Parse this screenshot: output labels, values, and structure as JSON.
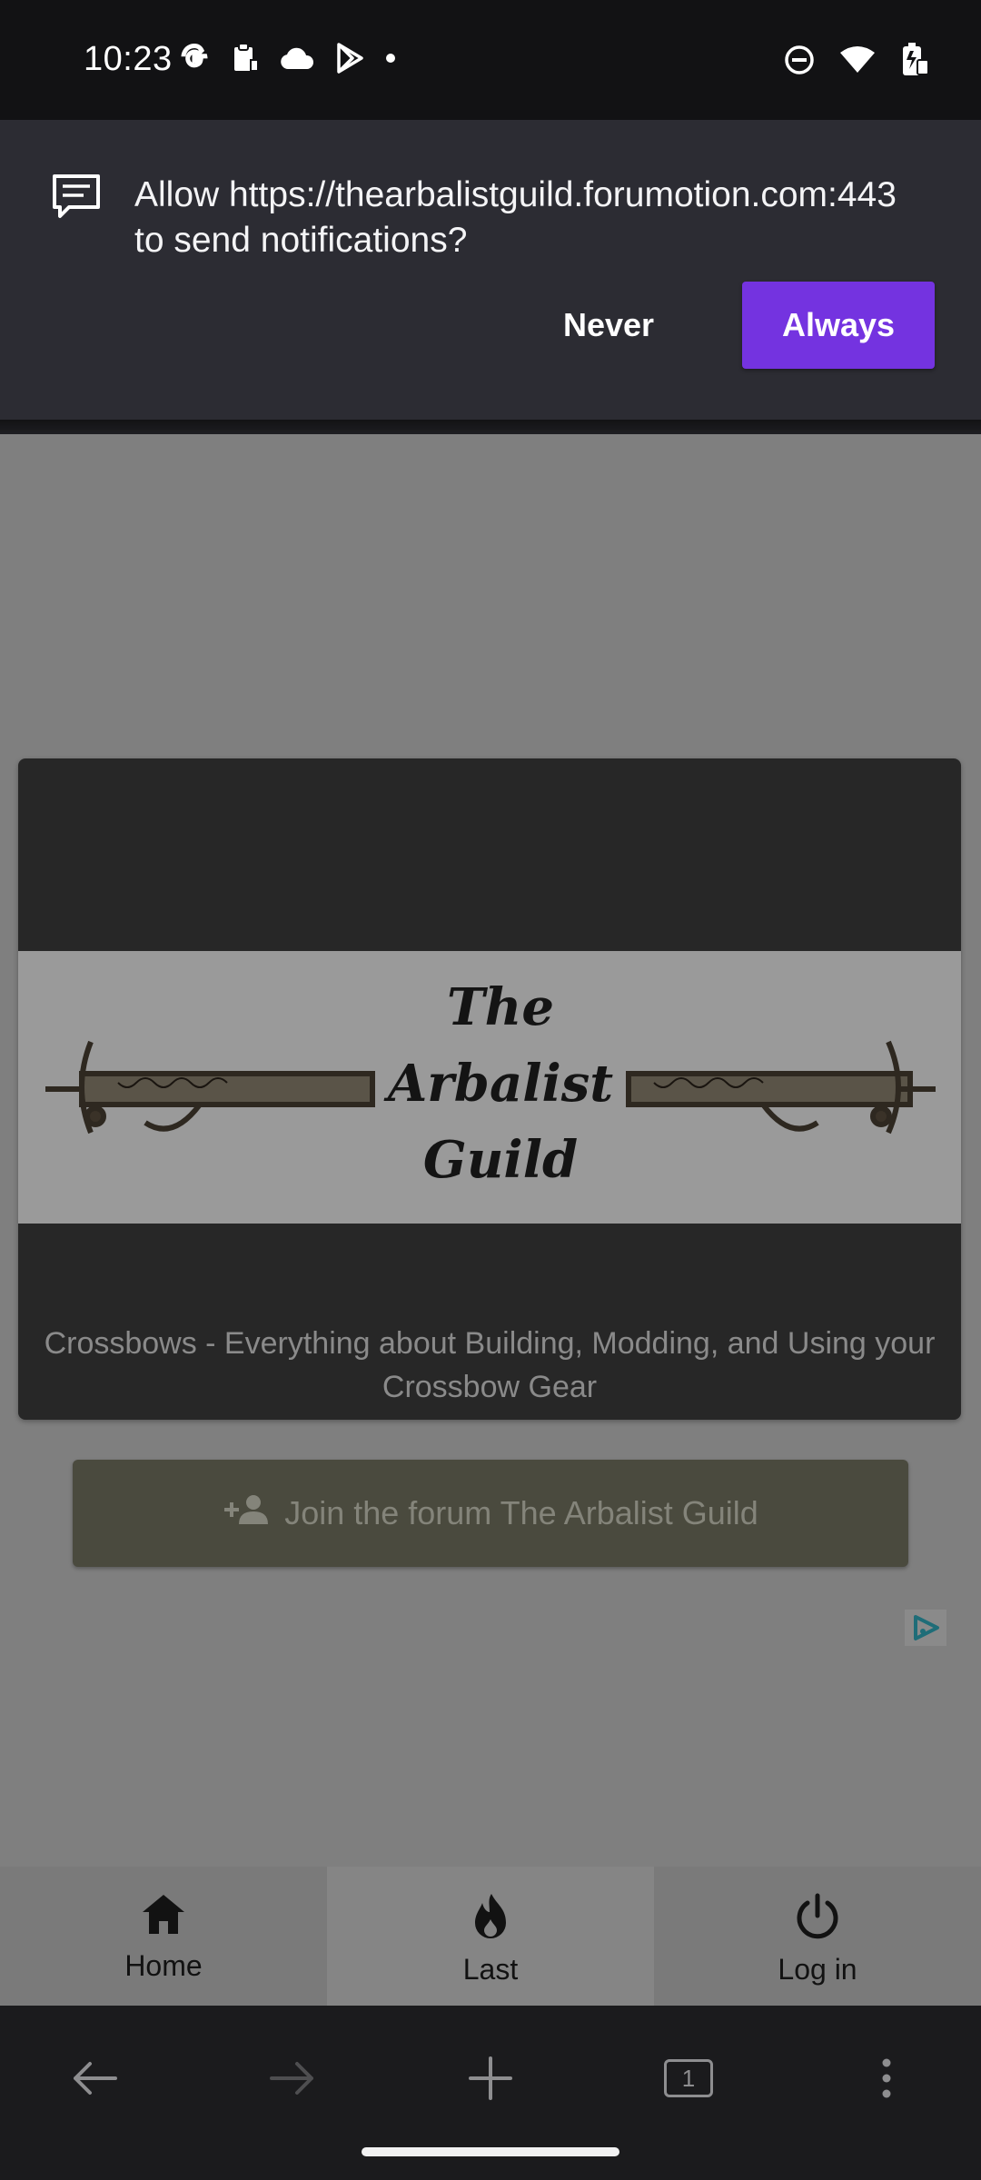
{
  "status_bar": {
    "time": "10:23",
    "left_icons": [
      "google-icon",
      "clipboard-icon",
      "cloud-icon",
      "play-store-icon",
      "dot-icon"
    ],
    "right_icons": [
      "do-not-disturb-icon",
      "wifi-icon",
      "battery-icon"
    ]
  },
  "notification_prompt": {
    "message": "Allow https://thearbalistguild.forumotion.com:443 to send notifications?",
    "never_label": "Never",
    "always_label": "Always",
    "accent_color": "#7433e0"
  },
  "banner": {
    "logo_text": [
      "The",
      "Arbalist",
      "Guild"
    ],
    "tagline": "Crossbows - Everything about Building, Modding, and Using your Crossbow Gear"
  },
  "join_button": {
    "label": "Join the forum The Arbalist Guild"
  },
  "forum_nav": {
    "items": [
      {
        "label": "Home",
        "icon": "home-icon"
      },
      {
        "label": "Last",
        "icon": "flame-icon"
      },
      {
        "label": "Log in",
        "icon": "power-icon"
      }
    ]
  },
  "browser_toolbar": {
    "tab_count": "1",
    "buttons": [
      "back-arrow-icon",
      "forward-arrow-icon",
      "new-tab-plus-icon",
      "tab-switcher-icon",
      "more-menu-icon"
    ]
  }
}
